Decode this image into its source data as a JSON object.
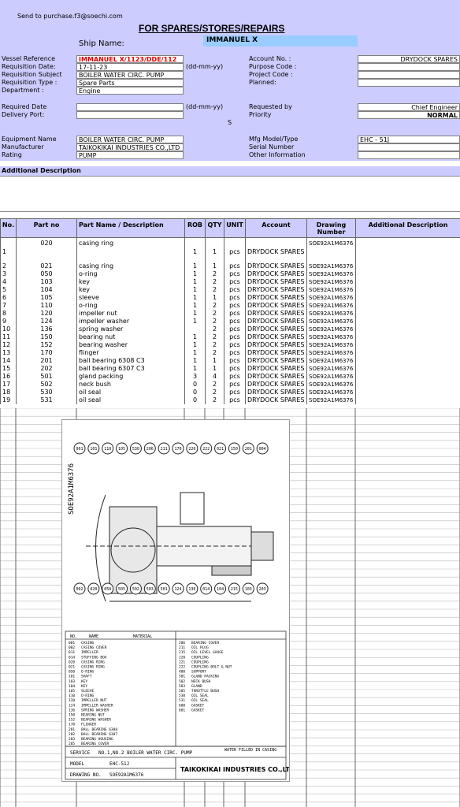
{
  "header": {
    "send_to": "Send to purchase.f3@soechi.com",
    "title": "FOR SPARES/STORES/REPAIRS",
    "ship_name_label": "Ship Name:",
    "ship_name": "IMMANUEL X"
  },
  "left_fields": {
    "vessel_reference_label": "Vessel Reference",
    "vessel_reference": "IMMANUEL X/1123/DDE/112",
    "requisition_date_label": "Requisition Date:",
    "requisition_date": "17-11-23",
    "date_format_1": "(dd-mm-yy)",
    "requisition_subject_label": "Requisition Subject",
    "requisition_subject": "BOILER WATER CIRC. PUMP",
    "requisition_type_label": "Requisition Type :",
    "requisition_type": "Spare Parts",
    "department_label": "Department :",
    "department": "Engine",
    "required_date_label": "Required Date",
    "required_date": "",
    "date_format_2": "(dd-mm-yy)",
    "delivery_port_label": "Delivery Port:",
    "delivery_port": "",
    "small_s": "S"
  },
  "right_fields": {
    "account_no_label": "Account No. :",
    "account_no": "DRYDOCK SPARES",
    "purpose_code_label": "Purpose Code :",
    "project_code_label": "Project Code :",
    "planned_label": "Planned:",
    "requested_by_label": "Requested by",
    "requested_by": "Chief Engineer",
    "priority_label": "Priority",
    "priority": "NORMAL"
  },
  "equipment": {
    "equipment_name_label": "Equipment Name",
    "equipment_name": "BOILER WATER CIRC. PUMP",
    "manufacturer_label": "Manufacturer",
    "manufacturer": "TAIKOKIKAI INDUSTRIES CO.,LTD",
    "rating_label": "Rating",
    "rating": "PUMP",
    "mfg_model_label": "Mfg Model/Type",
    "mfg_model": "EHC - 51J",
    "serial_number_label": "Serial Number",
    "other_info_label": "Other Information"
  },
  "additional_description_label": "Additional Description",
  "table": {
    "headers": [
      "No.",
      "Part no",
      "Part Name / Description",
      "ROB",
      "QTY",
      "UNIT",
      "Account",
      "Drawing Number",
      "Additional Description"
    ],
    "rows": [
      [
        "1",
        "020",
        "casing ring",
        "1",
        "1",
        "pcs",
        "DRYDOCK SPARES",
        "SOE92A1M6376",
        ""
      ],
      [
        "2",
        "021",
        "casing ring",
        "1",
        "1",
        "pcs",
        "DRYDOCK SPARES",
        "SOE92A1M6376",
        ""
      ],
      [
        "3",
        "050",
        "o-ring",
        "1",
        "2",
        "pcs",
        "DRYDOCK SPARES",
        "SOE92A1M6376",
        ""
      ],
      [
        "4",
        "103",
        "key",
        "1",
        "2",
        "pcs",
        "DRYDOCK SPARES",
        "SOE92A1M6376",
        ""
      ],
      [
        "5",
        "104",
        "key",
        "1",
        "2",
        "pcs",
        "DRYDOCK SPARES",
        "SOE92A1M6376",
        ""
      ],
      [
        "6",
        "105",
        "sleeve",
        "1",
        "1",
        "pcs",
        "DRYDOCK SPARES",
        "SOE92A1M6376",
        ""
      ],
      [
        "7",
        "110",
        "o-ring",
        "1",
        "2",
        "pcs",
        "DRYDOCK SPARES",
        "SOE92A1M6376",
        ""
      ],
      [
        "8",
        "120",
        "impeller nut",
        "1",
        "2",
        "pcs",
        "DRYDOCK SPARES",
        "SOE92A1M6376",
        ""
      ],
      [
        "9",
        "124",
        "impeller washer",
        "1",
        "2",
        "pcs",
        "DRYDOCK SPARES",
        "SOE92A1M6376",
        ""
      ],
      [
        "10",
        "136",
        "spring washer",
        "",
        "2",
        "pcs",
        "DRYDOCK SPARES",
        "SOE92A1M6376",
        ""
      ],
      [
        "11",
        "150",
        "bearing nut",
        "1",
        "2",
        "pcs",
        "DRYDOCK SPARES",
        "SOE92A1M6376",
        ""
      ],
      [
        "12",
        "152",
        "bearing washer",
        "1",
        "2",
        "pcs",
        "DRYDOCK SPARES",
        "SOE92A1M6376",
        ""
      ],
      [
        "13",
        "170",
        "flinger",
        "1",
        "2",
        "pcs",
        "DRYDOCK SPARES",
        "SOE92A1M6376",
        ""
      ],
      [
        "14",
        "201",
        "ball bearing 6308 C3",
        "1",
        "1",
        "pcs",
        "DRYDOCK SPARES",
        "SOE92A1M6376",
        ""
      ],
      [
        "15",
        "202",
        "ball bearing 6307 C3",
        "1",
        "1",
        "pcs",
        "DRYDOCK SPARES",
        "SOE92A1M6376",
        ""
      ],
      [
        "16",
        "501",
        "gland packing",
        "3",
        "4",
        "pcs",
        "DRYDOCK SPARES",
        "SOE92A1M6376",
        ""
      ],
      [
        "17",
        "502",
        "neck bush",
        "0",
        "2",
        "pcs",
        "DRYDOCK SPARES",
        "SOE92A1M6376",
        ""
      ],
      [
        "18",
        "530",
        "oil seal",
        "0",
        "2",
        "pcs",
        "DRYDOCK SPARES",
        "SOE92A1M6376",
        ""
      ],
      [
        "19",
        "531",
        "oil seal",
        "0",
        "2",
        "pcs",
        "DRYDOCK SPARES",
        "SOE92A1M6376",
        ""
      ]
    ]
  },
  "drawing": {
    "title_block_service_label": "SERVICE",
    "title_block_service": "NO.1,NO.2 BOILER WATER CIRC. PUMP",
    "title_block_model_label": "MODEL",
    "title_block_model": "EHC-51J",
    "title_block_drawing_label": "DRAWING NO.",
    "title_block_drawing": "SOE92A1M6376",
    "maker": "TAIKOKIKAI INDUSTRIES CO.,LTD.",
    "water_note": "WATER FILLED IN CASING",
    "table_header_no": "NO.",
    "table_header_name": "NAME",
    "table_header_material": "MATERIAL",
    "parts_left": [
      [
        "001",
        "CASING"
      ],
      [
        "002",
        "CASING COVER"
      ],
      [
        "011",
        "IMPELLER"
      ],
      [
        "014",
        "STUFFING BOX"
      ],
      [
        "020",
        "CASING RING"
      ],
      [
        "021",
        "CASING RING"
      ],
      [
        "050",
        "O-RING"
      ],
      [
        "101",
        "SHAFT"
      ],
      [
        "103",
        "KEY"
      ],
      [
        "104",
        "KEY"
      ],
      [
        "105",
        "SLEEVE"
      ],
      [
        "110",
        "O-RING"
      ],
      [
        "120",
        "IMPELLER NUT"
      ],
      [
        "124",
        "IMPELLER WASHER"
      ],
      [
        "136",
        "SPRING WASHER"
      ],
      [
        "150",
        "BEARING NUT"
      ],
      [
        "152",
        "BEARING WASHER"
      ],
      [
        "170",
        "FLINGER"
      ],
      [
        "201",
        "BALL BEARING 6308"
      ],
      [
        "202",
        "BALL BEARING 6307"
      ],
      [
        "203",
        "BEARING HOUSING"
      ],
      [
        "205",
        "BEARING COVER"
      ]
    ],
    "parts_right": [
      [
        "206",
        "BEARING COVER"
      ],
      [
        "211",
        "OIL PLUG"
      ],
      [
        "215",
        "OIL LEVEL GAUGE"
      ],
      [
        "220",
        "COUPLING"
      ],
      [
        "221",
        "COUPLING"
      ],
      [
        "222",
        "COUPLING BOLT & NUT"
      ],
      [
        "400",
        "SUPPORT"
      ],
      [
        "501",
        "GLAND PACKING"
      ],
      [
        "502",
        "NECK BUSH"
      ],
      [
        "503",
        "GLAND"
      ],
      [
        "505",
        "THROTTLE BUSH"
      ],
      [
        "530",
        "OIL SEAL"
      ],
      [
        "531",
        "OIL SEAL"
      ],
      [
        "600",
        "GASKET"
      ],
      [
        "601",
        "GASKET"
      ]
    ],
    "balloons_top": [
      "001",
      "101",
      "110",
      "105",
      "530",
      "206",
      "211",
      "170",
      "220",
      "222",
      "021",
      "150",
      "201",
      "004"
    ],
    "balloons_bottom": [
      "002",
      "020",
      "050",
      "505",
      "502",
      "503",
      "501",
      "124",
      "136",
      "014",
      "104",
      "215",
      "103",
      "203"
    ],
    "side_text": "SOE92A1M6376"
  }
}
